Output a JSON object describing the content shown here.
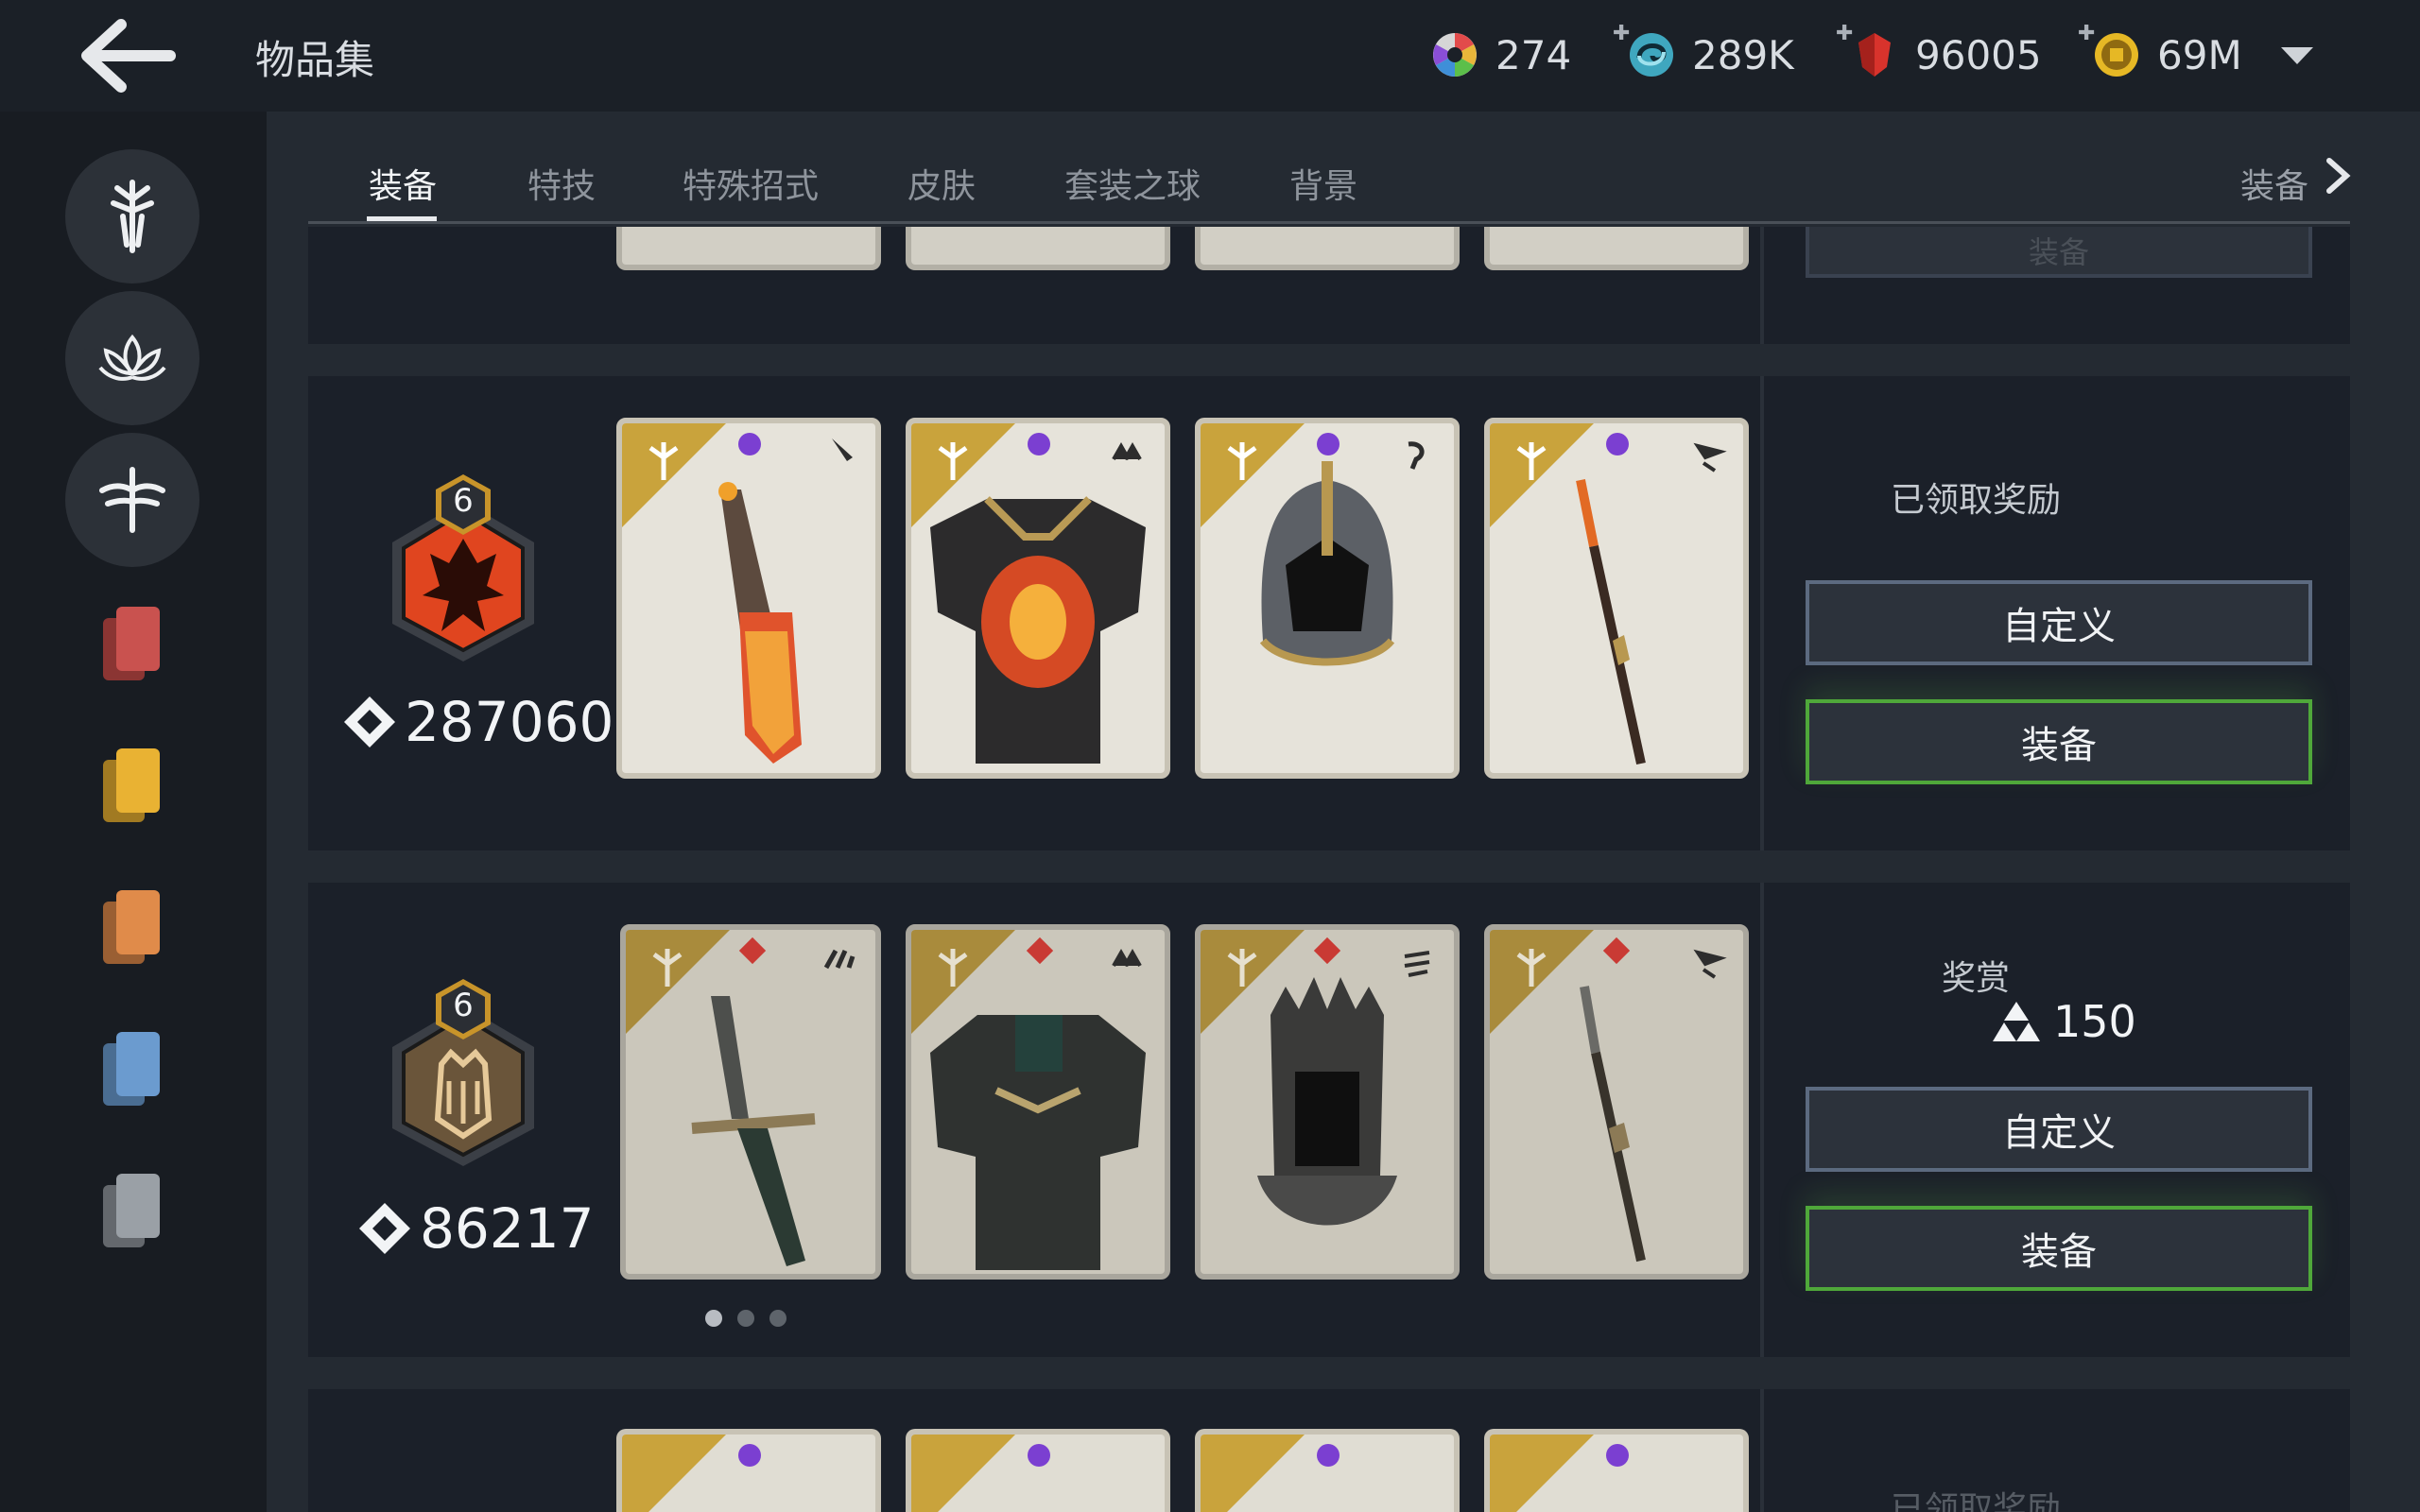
{
  "header": {
    "title": "物品集",
    "currencies": [
      {
        "name": "color-shards",
        "value": "274",
        "has_plus": false
      },
      {
        "name": "steel",
        "value": "289K",
        "has_plus": true
      },
      {
        "name": "crystals",
        "value": "96005",
        "has_plus": true
      },
      {
        "name": "coins",
        "value": "69M",
        "has_plus": true
      }
    ]
  },
  "tabs": [
    {
      "label": "装备",
      "active": true
    },
    {
      "label": "特技",
      "active": false
    },
    {
      "label": "特殊招式",
      "active": false
    },
    {
      "label": "皮肤",
      "active": false
    },
    {
      "label": "套装之球",
      "active": false
    },
    {
      "label": "背景",
      "active": false
    }
  ],
  "tab_right_label": "装备",
  "sidebar": {
    "items": [
      {
        "icon": "knight-helm-icon"
      },
      {
        "icon": "lotus-icon"
      },
      {
        "icon": "dragonfly-icon"
      },
      {
        "icon": "red-cards-icon",
        "color": "#c9524f"
      },
      {
        "icon": "yellow-cards-icon",
        "color": "#e9b233"
      },
      {
        "icon": "orange-cards-icon",
        "color": "#e08b4a"
      },
      {
        "icon": "blue-cards-icon",
        "color": "#6b9bcf"
      },
      {
        "icon": "gray-cards-icon",
        "color": "#9aa0a6"
      }
    ]
  },
  "rows": [
    {
      "partial": "top",
      "button_label": "装备"
    },
    {
      "badge_level": "6",
      "badge_color": "#e0451f",
      "score": "287060",
      "status": "已领取奖励",
      "customize_label": "自定义",
      "equip_label": "装备",
      "items": [
        "sword",
        "chest-armor",
        "helmet",
        "spear"
      ]
    },
    {
      "badge_level": "6",
      "badge_color": "#6a553a",
      "score": "86217",
      "reward_label": "奖赏",
      "reward_value": "150",
      "customize_label": "自定义",
      "equip_label": "装备",
      "items": [
        "sword",
        "chest-armor",
        "helmet",
        "spear"
      ],
      "page_dots": 3
    },
    {
      "partial": "bottom",
      "status": "已领取奖励"
    }
  ],
  "colors": {
    "accent_gold": "#c9a33c",
    "rarity_purple": "#7b3fd1",
    "rarity_red": "#c93a34",
    "equip_border": "#4fa83a",
    "custom_border": "#5c6a80"
  }
}
